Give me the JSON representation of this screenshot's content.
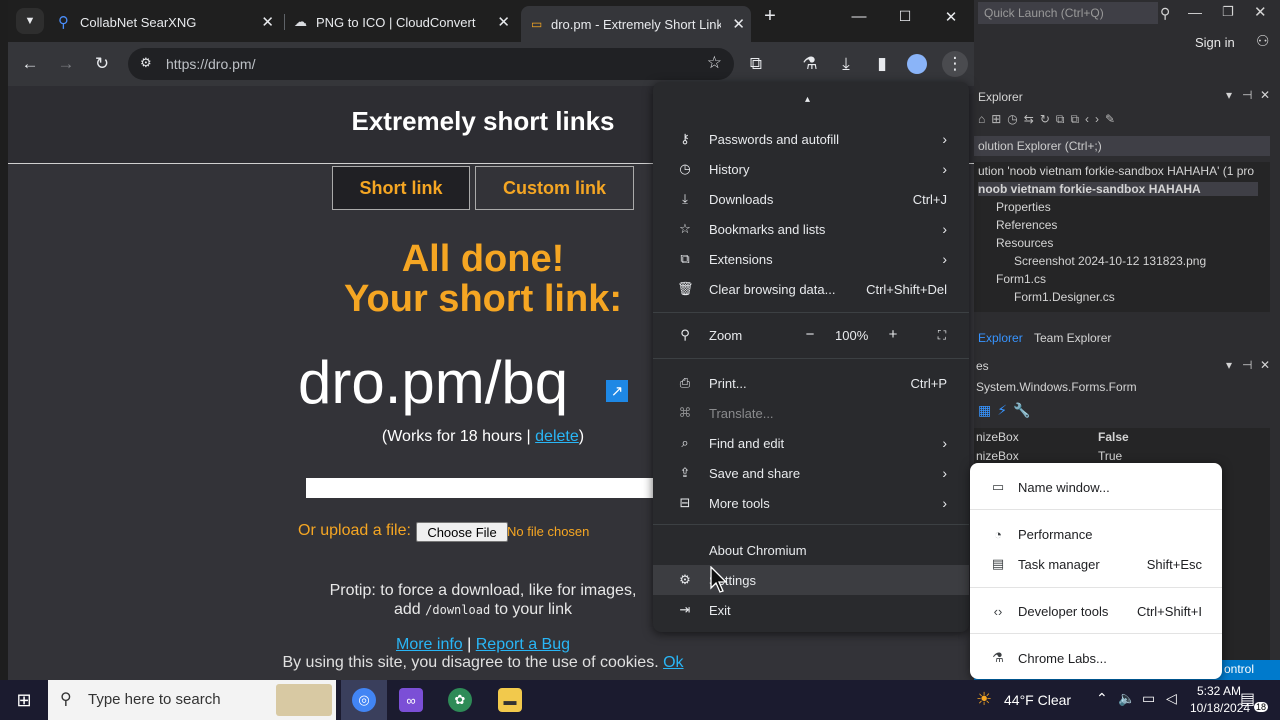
{
  "browser": {
    "tabs": [
      {
        "title": "CollabNet SearXNG"
      },
      {
        "title": "PNG to ICO | CloudConvert"
      },
      {
        "title": "dro.pm - Extremely Short Link"
      }
    ],
    "url": "https://dro.pm/"
  },
  "page": {
    "header": "Extremely short links",
    "tab_short": "Short link",
    "tab_custom": "Custom link",
    "done_line1": "All done!",
    "done_line2": "Your short link:",
    "short_url": "dro.pm/bq",
    "works_prefix": "(Works for 18 hours | ",
    "delete_label": "delete",
    "works_suffix": ")",
    "upload_label": "Or upload a file:",
    "choose_file": "Choose File",
    "no_file": "No file chosen",
    "protip_line1": "Protip: to force a download, like for images,",
    "protip_add": "add ",
    "protip_code": "/download",
    "protip_end": " to your link",
    "more_info": "More info",
    "sep": " | ",
    "report_bug": "Report a Bug",
    "cookie_text": "By using this site, you disagree to the use of cookies. ",
    "cookie_ok": "Ok"
  },
  "menu": {
    "caret": "▴",
    "items": [
      {
        "label": "Passwords and autofill"
      },
      {
        "label": "History"
      },
      {
        "label": "Downloads",
        "shortcut": "Ctrl+J"
      },
      {
        "label": "Bookmarks and lists"
      },
      {
        "label": "Extensions"
      },
      {
        "label": "Clear browsing data...",
        "shortcut": "Ctrl+Shift+Del"
      }
    ],
    "zoom": {
      "label": "Zoom",
      "minus": "−",
      "value": "100%",
      "plus": "+"
    },
    "items2": [
      {
        "label": "Print...",
        "shortcut": "Ctrl+P"
      },
      {
        "label": "Translate..."
      },
      {
        "label": "Find and edit"
      },
      {
        "label": "Save and share"
      },
      {
        "label": "More tools"
      }
    ],
    "items3": [
      {
        "label": "About Chromium"
      },
      {
        "label": "Settings"
      },
      {
        "label": "Exit"
      }
    ]
  },
  "submenu": {
    "items": [
      {
        "label": "Name window..."
      },
      {
        "label": "Performance"
      },
      {
        "label": "Task manager",
        "shortcut": "Shift+Esc"
      },
      {
        "label": "Developer tools",
        "shortcut": "Ctrl+Shift+I"
      },
      {
        "label": "Chrome Labs..."
      }
    ]
  },
  "vs": {
    "quick_launch": "Quick Launch (Ctrl+Q)",
    "sign_in": "Sign in",
    "explorer_title": "Explorer",
    "search_placeholder": "olution Explorer (Ctrl+;)",
    "tree": [
      "ution 'noob vietnam forkie-sandbox HAHAHA' (1 pro",
      "noob vietnam forkie-sandbox HAHAHA",
      "Properties",
      "References",
      "Resources",
      "Screenshot 2024-10-12 131823.png",
      "Form1.cs",
      "Form1.Designer.cs"
    ],
    "tab_explorer": "Explorer",
    "tab_team": "Team Explorer",
    "props_title": "es",
    "props_object": "System.Windows.Forms.Form",
    "props": [
      {
        "name": "nizeBox",
        "value": "False"
      },
      {
        "name": "nizeBox",
        "value": "True"
      }
    ],
    "status_right": "ontrol"
  },
  "taskbar": {
    "search_placeholder": "Type here to search",
    "weather": "44°F  Clear",
    "time": "5:32 AM",
    "date": "10/18/2024",
    "notif_count": "18"
  }
}
